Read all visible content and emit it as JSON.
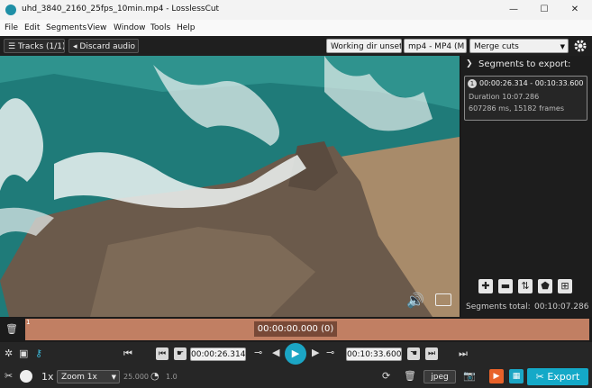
{
  "window": {
    "title": "uhd_3840_2160_25fps_10min.mp4 - LosslessCut",
    "minimize_glyph": "—",
    "maximize_glyph": "☐",
    "close_glyph": "✕"
  },
  "menu": [
    "File",
    "Edit",
    "Segments",
    "View",
    "Window",
    "Tools",
    "Help"
  ],
  "toolbar": {
    "tracks_label": "Tracks (1/1)",
    "discard_audio_label": "Discard audio",
    "working_dir_label": "Working dir unset",
    "format_label": "mp4 - MP4 (M",
    "merge_label": "Merge cuts"
  },
  "segments_panel": {
    "header": "Segments to export:",
    "segment": {
      "index": "1",
      "range": "00:00:26.314 - 00:10:33.600",
      "duration": "Duration 10:07.286",
      "frames": "607286 ms, 15182 frames"
    },
    "total_label": "Segments total:",
    "total_value": "00:10:07.286"
  },
  "timeline": {
    "marker": "1",
    "current_time": "00:00:00.000 (0)"
  },
  "controls": {
    "cut_start_time": "00:00:26.314",
    "cut_end_time": "00:10:33.600"
  },
  "bottom": {
    "speed_label": "1x",
    "zoom_label": "Zoom 1x",
    "fps_value": "25.000",
    "speed_value": "1.0",
    "capture_format": "jpeg",
    "export_label": "Export"
  },
  "colors": {
    "accent": "#1ba5c4",
    "timeline_bar": "#c17f63",
    "export_bg": "#14a9c8",
    "orange_button": "#e8622a"
  }
}
